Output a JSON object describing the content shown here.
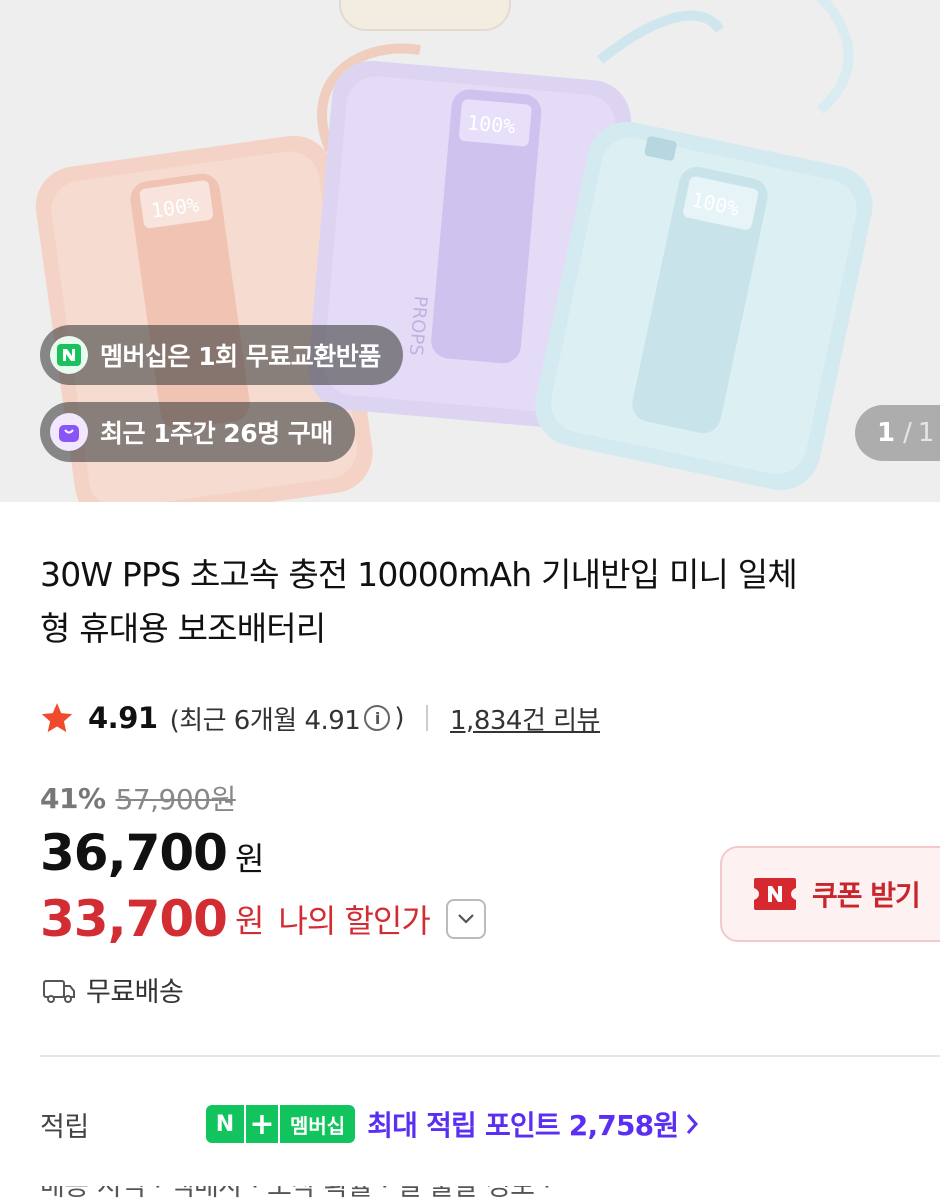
{
  "hero": {
    "image_description_icon": "power-bank-product-photo",
    "pills": [
      {
        "icon": "naver-n-icon",
        "text": "멤버십은 1회 무료교환반품"
      },
      {
        "icon": "shopping-bag-icon",
        "text": "최근 1주간 26명 구매"
      }
    ],
    "counter": {
      "current": "1",
      "separator": "/",
      "total": "1"
    }
  },
  "product": {
    "title_line1": "30W PPS 초고속 충전 10000mAh 기내반입 미니 일체",
    "title_line2": "형 휴대용 보조배터리"
  },
  "rating": {
    "score": "4.91",
    "recent_prefix": "(최근 6개월 4.91",
    "recent_suffix": ")",
    "info_glyph": "i",
    "reviews": "1,834건 리뷰"
  },
  "price": {
    "discount_rate": "41%",
    "original": "57,900원",
    "sale": "36,700",
    "currency": "원",
    "my_price": "33,700",
    "my_price_label": "나의 할인가"
  },
  "coupon": {
    "label": "쿠폰 받기"
  },
  "shipping": {
    "label": "무료배송"
  },
  "points": {
    "label": "적립",
    "badge_n": "N",
    "badge_plus": "+",
    "badge_text": "멤버십",
    "text": "최대 적립 포인트 2,758원"
  },
  "next_row_partial": "배송        지역 · 택배사 · 도착 확률 · 일 출발 정보 ·"
}
